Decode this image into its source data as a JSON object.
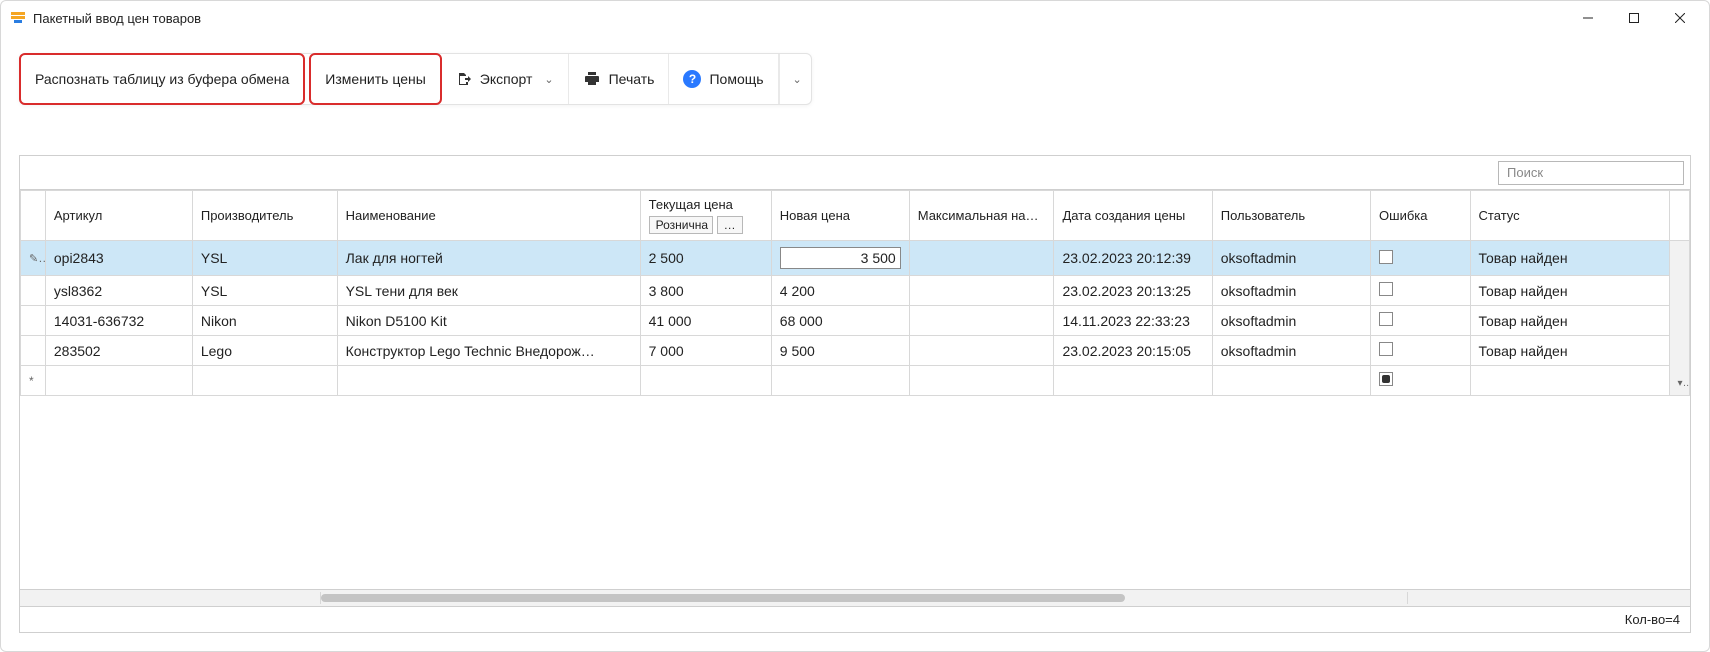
{
  "window": {
    "title": "Пакетный ввод цен товаров"
  },
  "toolbar": {
    "recognize": "Распознать таблицу из буфера обмена",
    "change_prices": "Изменить цены",
    "export": "Экспорт",
    "print": "Печать",
    "help": "Помощь"
  },
  "grid": {
    "search_placeholder": "Поиск",
    "columns": {
      "article": "Артикул",
      "manufacturer": "Производитель",
      "name": "Наименование",
      "current_price": "Текущая цена",
      "current_price_sub": "Рознична",
      "new_price": "Новая цена",
      "max_markup": "Максимальная наценка",
      "price_date": "Дата создания цены",
      "user": "Пользователь",
      "error": "Ошибка",
      "status": "Статус"
    },
    "rows": [
      {
        "article": "opi2843",
        "manufacturer": "YSL",
        "name": "Лак для ногтей",
        "current_price": "2 500",
        "new_price": "3 500",
        "max_markup": "",
        "price_date": "23.02.2023 20:12:39",
        "user": "oksoftadmin",
        "error": false,
        "status": "Товар найден",
        "selected": true,
        "editing_new_price": true
      },
      {
        "article": "ysl8362",
        "manufacturer": "YSL",
        "name": "YSL тени для век",
        "current_price": "3 800",
        "new_price": "4 200",
        "max_markup": "",
        "price_date": "23.02.2023 20:13:25",
        "user": "oksoftadmin",
        "error": false,
        "status": "Товар найден"
      },
      {
        "article": "14031-636732",
        "manufacturer": "Nikon",
        "name": "Nikon D5100 Kit",
        "current_price": "41 000",
        "new_price": "68 000",
        "max_markup": "",
        "price_date": "14.11.2023 22:33:23",
        "user": "oksoftadmin",
        "error": false,
        "status": "Товар найден"
      },
      {
        "article": "283502",
        "manufacturer": "Lego",
        "name": "Конструктор Lego Technic Внедорож…",
        "current_price": "7 000",
        "new_price": "9 500",
        "max_markup": "",
        "price_date": "23.02.2023 20:15:05",
        "user": "oksoftadmin",
        "error": false,
        "status": "Товар найден"
      }
    ],
    "footer_count": "Кол-во=4"
  }
}
